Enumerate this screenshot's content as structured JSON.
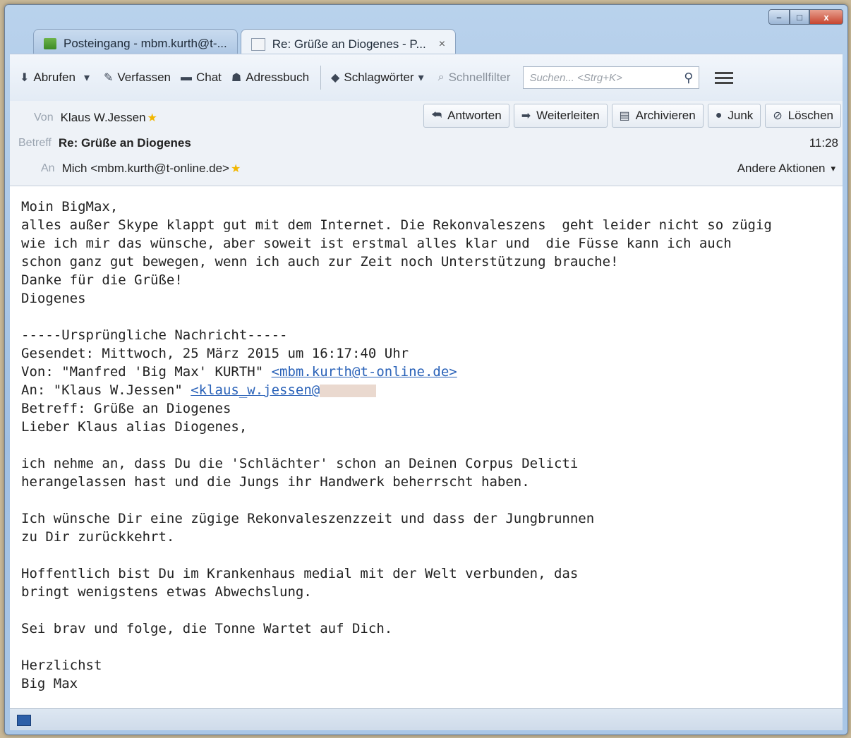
{
  "window": {
    "tabs": [
      {
        "label": "Posteingang - mbm.kurth@t-...",
        "icon": "inbox-icon"
      },
      {
        "label": "Re: Grüße an Diogenes - P...",
        "icon": "mail-icon",
        "close": "×"
      }
    ],
    "controls": {
      "minimize": "–",
      "maximize": "□",
      "close": "x"
    }
  },
  "toolbar": {
    "abrufen": "Abrufen",
    "verfassen": "Verfassen",
    "chat": "Chat",
    "adressbuch": "Adressbuch",
    "schlagwoerter": "Schlagwörter",
    "schnellfilter": "Schnellfilter",
    "search_placeholder": "Suchen... <Strg+K>"
  },
  "header": {
    "from_label": "Von",
    "from_value": "Klaus W.Jessen",
    "subject_label": "Betreff",
    "subject_value": "Re: Grüße an Diogenes",
    "to_label": "An",
    "to_value": "Mich <mbm.kurth@t-online.de>",
    "time": "11:28",
    "other_actions": "Andere Aktionen",
    "buttons": {
      "antworten": "Antworten",
      "weiterleiten": "Weiterleiten",
      "archivieren": "Archivieren",
      "junk": "Junk",
      "loeschen": "Löschen"
    }
  },
  "body": {
    "l1": "Moin BigMax,",
    "l2": "alles außer Skype klappt gut mit dem Internet. Die Rekonvaleszens  geht leider nicht so zügig",
    "l3": "wie ich mir das wünsche, aber soweit ist erstmal alles klar und  die Füsse kann ich auch",
    "l4": "schon ganz gut bewegen, wenn ich auch zur Zeit noch Unterstützung brauche!",
    "l5": "Danke für die Grüße!",
    "l6": "Diogenes",
    "q1": "-----Ursprüngliche Nachricht-----",
    "q2": "Gesendet: Mittwoch, 25 März 2015 um 16:17:40 Uhr",
    "q3_prefix": "Von: \"Manfred 'Big Max' KURTH\" ",
    "q3_link": "<mbm.kurth@t-online.de>",
    "q4_prefix": "An: \"Klaus W.Jessen\" ",
    "q4_link": "<klaus_w.jessen@",
    "q5": "Betreff: Grüße an Diogenes",
    "q6": "Lieber Klaus alias Diogenes,",
    "p1a": "ich nehme an, dass Du die 'Schlächter' schon an Deinen Corpus Delicti",
    "p1b": "herangelassen hast und die Jungs ihr Handwerk beherrscht haben.",
    "p2a": "Ich wünsche Dir eine zügige Rekonvaleszenzzeit und dass der Jungbrunnen",
    "p2b": "zu Dir zurückkehrt.",
    "p3a": "Hoffentlich bist Du im Krankenhaus medial mit der Welt verbunden, das",
    "p3b": "bringt wenigstens etwas Abwechslung.",
    "p4": "Sei brav und folge, die Tonne Wartet auf Dich.",
    "p5a": "Herzlichst",
    "p5b": "Big Max"
  }
}
